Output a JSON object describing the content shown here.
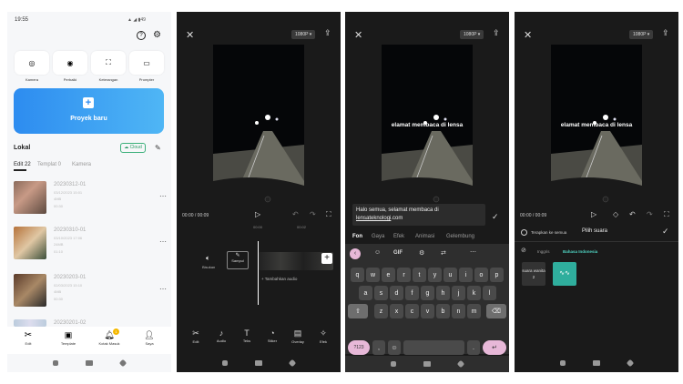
{
  "home": {
    "status_time": "19:55",
    "status_battery": "49",
    "quick_actions": [
      "Kamera",
      "Perbaiki",
      "Keterangan",
      "Prompter"
    ],
    "new_project": "Proyek baru",
    "local": "Lokal",
    "cloud": "Cloud",
    "tabs": [
      "Edit 22",
      "Templat 0",
      "Kamera"
    ],
    "items": [
      {
        "title": "20230312-01",
        "date": "03/12/2023 15:01",
        "size": "4MB",
        "dur": "00:30"
      },
      {
        "title": "20230310-01",
        "date": "03/10/2023 17:06",
        "size": "24MB",
        "dur": "01:10"
      },
      {
        "title": "20230203-01",
        "date": "02/03/2023 15:10",
        "size": "4MB",
        "dur": "00:30"
      },
      {
        "title": "20230201-02",
        "date": "",
        "size": "",
        "dur": ""
      }
    ],
    "nav": [
      "Edit",
      "Template",
      "Kotak Masuk",
      "Saya"
    ],
    "badge": "1"
  },
  "editor": {
    "resolution": "1080P ▾",
    "time": "00:00 / 00:09",
    "ruler": [
      "00:00",
      "00:02"
    ],
    "bisukan": "Bisukan",
    "sampul": "Sampul",
    "add_audio": "+ Tambahkan audio",
    "tools": [
      "Edit",
      "Audio",
      "Teks",
      "Stiker",
      "Overlay",
      "Efek"
    ]
  },
  "text_editor": {
    "caption": "elamat membaca di lensa",
    "input_line1": "Halo semua, selamat membaca di",
    "input_link": "lensateknologi",
    "input_end": ".com",
    "style_tabs": [
      "Fon",
      "Gaya",
      "Efek",
      "Animasi",
      "Gelembung"
    ],
    "kb_tools": [
      "GIF"
    ],
    "rows": [
      [
        "q",
        "w",
        "e",
        "r",
        "t",
        "y",
        "u",
        "i",
        "o",
        "p"
      ],
      [
        "a",
        "s",
        "d",
        "f",
        "g",
        "h",
        "j",
        "k",
        "l"
      ],
      [
        "z",
        "x",
        "c",
        "v",
        "b",
        "n",
        "m"
      ]
    ],
    "sym": "?123",
    "comma": ",",
    "period": "."
  },
  "tts": {
    "apply_all": "Terapkan ke semua",
    "choose_voice": "Pilih suara",
    "langs": [
      "Inggris",
      "Bahasa Indonesia"
    ],
    "voice": "suara wanita 2"
  }
}
